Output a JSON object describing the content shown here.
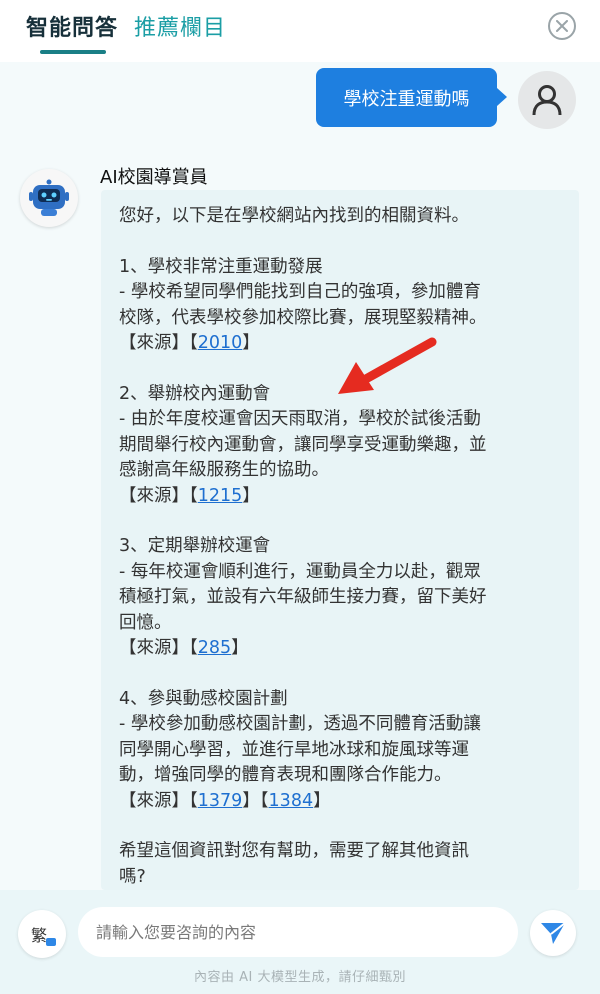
{
  "header": {
    "tabs": [
      {
        "label": "智能問答"
      },
      {
        "label": "推薦欄目"
      }
    ],
    "close_icon": "close-circle-icon"
  },
  "user_message": {
    "text": "學校注重運動嗎",
    "avatar_icon": "user-icon"
  },
  "bot": {
    "name": "AI校園導賞員",
    "avatar_icon": "robot-icon",
    "intro": "您好，以下是在學校網站內找到的相關資料。",
    "items": [
      {
        "title": "1、學校非常注重運動發展",
        "lines": [
          "- 學校希望同學們能找到自己的強項，參加體育",
          "校隊，代表學校參加校際比賽，展現堅毅精神。"
        ],
        "source_label": "【來源】",
        "refs": [
          "2010"
        ]
      },
      {
        "title": "2、舉辦校內運動會",
        "lines": [
          "- 由於年度校運會因天雨取消，學校於試後活動",
          "期間舉行校內運動會，讓同學享受運動樂趣，並",
          "感謝高年級服務生的協助。"
        ],
        "source_label": "【來源】",
        "refs": [
          "1215"
        ]
      },
      {
        "title": "3、定期舉辦校運會",
        "lines": [
          "- 每年校運會順利進行，運動員全力以赴，觀眾",
          "積極打氣，並設有六年級師生接力賽，留下美好",
          "回憶。"
        ],
        "source_label": "【來源】",
        "refs": [
          "285"
        ]
      },
      {
        "title": "4、參與動感校園計劃",
        "lines": [
          "- 學校參加動感校園計劃，透過不同體育活動讓",
          "同學開心學習，並進行旱地冰球和旋風球等運",
          "動，增強同學的體育表現和團隊合作能力。"
        ],
        "source_label": "【來源】",
        "refs": [
          "1379",
          "1384"
        ]
      }
    ],
    "closing": [
      "希望這個資訊對您有幫助，需要了解其他資訊",
      "嗎?"
    ]
  },
  "footer": {
    "lang_label": "繁",
    "input_placeholder": "請輸入您要咨詢的內容",
    "send_icon": "send-icon",
    "disclaimer": "內容由 AI 大模型生成，請仔細甄別"
  },
  "colors": {
    "accent": "#1b9ea5",
    "user_bubble": "#1e7fe0",
    "bot_bubble": "#e8f4f6",
    "annotation_arrow": "#e52b20"
  }
}
